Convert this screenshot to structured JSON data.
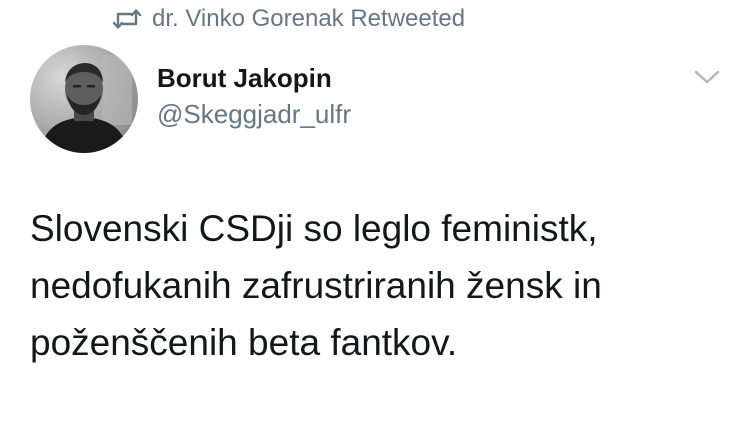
{
  "retweet": {
    "icon": "retweet-icon",
    "text": "dr. Vinko Gorenak Retweeted"
  },
  "tweet": {
    "author": {
      "display_name": "Borut Jakopin",
      "handle": "@Skeggjadr_ulfr",
      "avatar": "avatar-photo"
    },
    "menu_icon": "chevron-down-icon",
    "text_lines": [
      "Slovenski CSDji so leglo feministk,",
      "nedofukanih zafrustriranih žensk in",
      "poženščenih beta fantkov."
    ]
  },
  "colors": {
    "secondary_text": "#657786",
    "primary_text": "#14171a",
    "background": "#ffffff"
  }
}
